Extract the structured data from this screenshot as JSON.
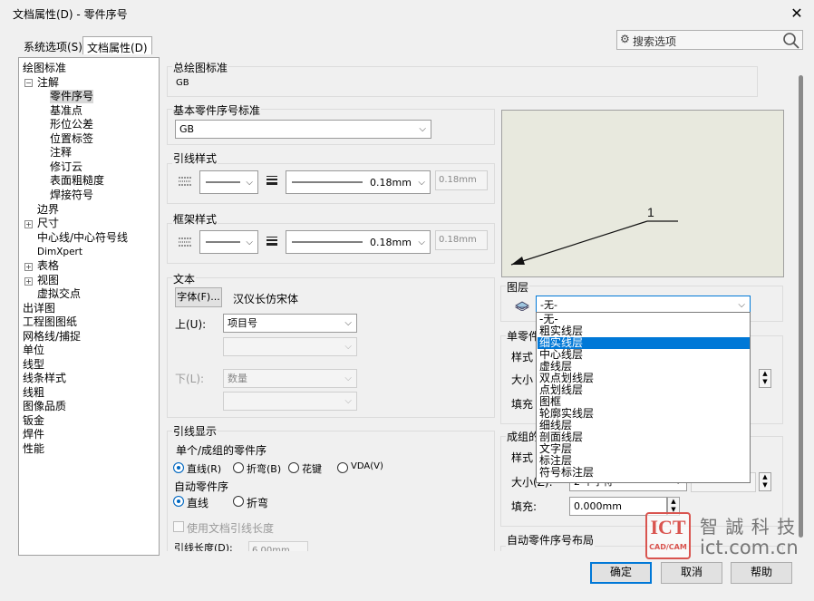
{
  "window": {
    "title": "文档属性(D) - 零件序号"
  },
  "tabs": {
    "system": "系统选项(S)",
    "document": "文档属性(D)"
  },
  "search": {
    "placeholder": "搜索选项"
  },
  "tree": [
    {
      "label": "绘图标准"
    },
    {
      "label": "注解"
    },
    {
      "label": "零件序号"
    },
    {
      "label": "基准点"
    },
    {
      "label": "形位公差"
    },
    {
      "label": "位置标签"
    },
    {
      "label": "注释"
    },
    {
      "label": "修订云"
    },
    {
      "label": "表面粗糙度"
    },
    {
      "label": "焊接符号"
    },
    {
      "label": "边界"
    },
    {
      "label": "尺寸"
    },
    {
      "label": "中心线/中心符号线"
    },
    {
      "label": "DimXpert"
    },
    {
      "label": "表格"
    },
    {
      "label": "视图"
    },
    {
      "label": "虚拟交点"
    },
    {
      "label": "出详图"
    },
    {
      "label": "工程图图纸"
    },
    {
      "label": "网格线/捕捉"
    },
    {
      "label": "单位"
    },
    {
      "label": "线型"
    },
    {
      "label": "线条样式"
    },
    {
      "label": "线粗"
    },
    {
      "label": "图像品质"
    },
    {
      "label": "钣金"
    },
    {
      "label": "焊件"
    },
    {
      "label": "性能"
    }
  ],
  "overall": {
    "title": "总绘图标准",
    "value": "GB"
  },
  "base": {
    "title": "基本零件序号标准",
    "value": "GB"
  },
  "leader_style": {
    "title": "引线样式",
    "thickness": "0.18mm",
    "custom": "0.18mm"
  },
  "frame_style": {
    "title": "框架样式",
    "thickness": "0.18mm",
    "custom": "0.18mm"
  },
  "text": {
    "title": "文本",
    "font_button": "字体(F)...",
    "font_name": "汉仪长仿宋体",
    "upper_label": "上(U):",
    "upper_value": "项目号",
    "lower_label": "下(L):",
    "lower_value": "数量"
  },
  "leader_display": {
    "title": "引线显示",
    "single_group": "单个/成组的零件序",
    "options": [
      "直线(R)",
      "折弯(B)",
      "花键",
      "VDA(V)"
    ],
    "auto": "自动零件序",
    "auto_options": [
      "直线",
      "折弯"
    ],
    "use_doc": "使用文档引线长度",
    "length_label": "引线长度(D):",
    "length_value": "6.00mm"
  },
  "layer": {
    "title": "图层",
    "selected": "-无-",
    "options": [
      "-无-",
      "粗实线层",
      "细实线层",
      "中心线层",
      "虚线层",
      "双点划线层",
      "点划线层",
      "图框",
      "轮廓实线层",
      "细线层",
      "剖面线层",
      "文字层",
      "标注层",
      "符号标注层"
    ],
    "highlighted_index": 2
  },
  "single_part": {
    "title": "单零件",
    "style": "样式",
    "size": "大小",
    "fill": "填充"
  },
  "group_part": {
    "title": "成组的",
    "style": "样式",
    "size": "大小(Z):",
    "size_value": "2 个字符",
    "fill": "填充:",
    "fill_value": "0.000mm"
  },
  "auto_layout": {
    "title": "自动零件序号布局"
  },
  "preview": {
    "label": "1"
  },
  "buttons": {
    "ok": "确定",
    "cancel": "取消",
    "help": "帮助"
  },
  "watermark": {
    "logo_top": "ICT",
    "logo_bottom": "CAD/CAM",
    "brand": "智 誠 科 技",
    "url": "ict.com.cn"
  },
  "colors": {
    "accent": "#0078d7",
    "watermark_red": "#d9544f"
  }
}
